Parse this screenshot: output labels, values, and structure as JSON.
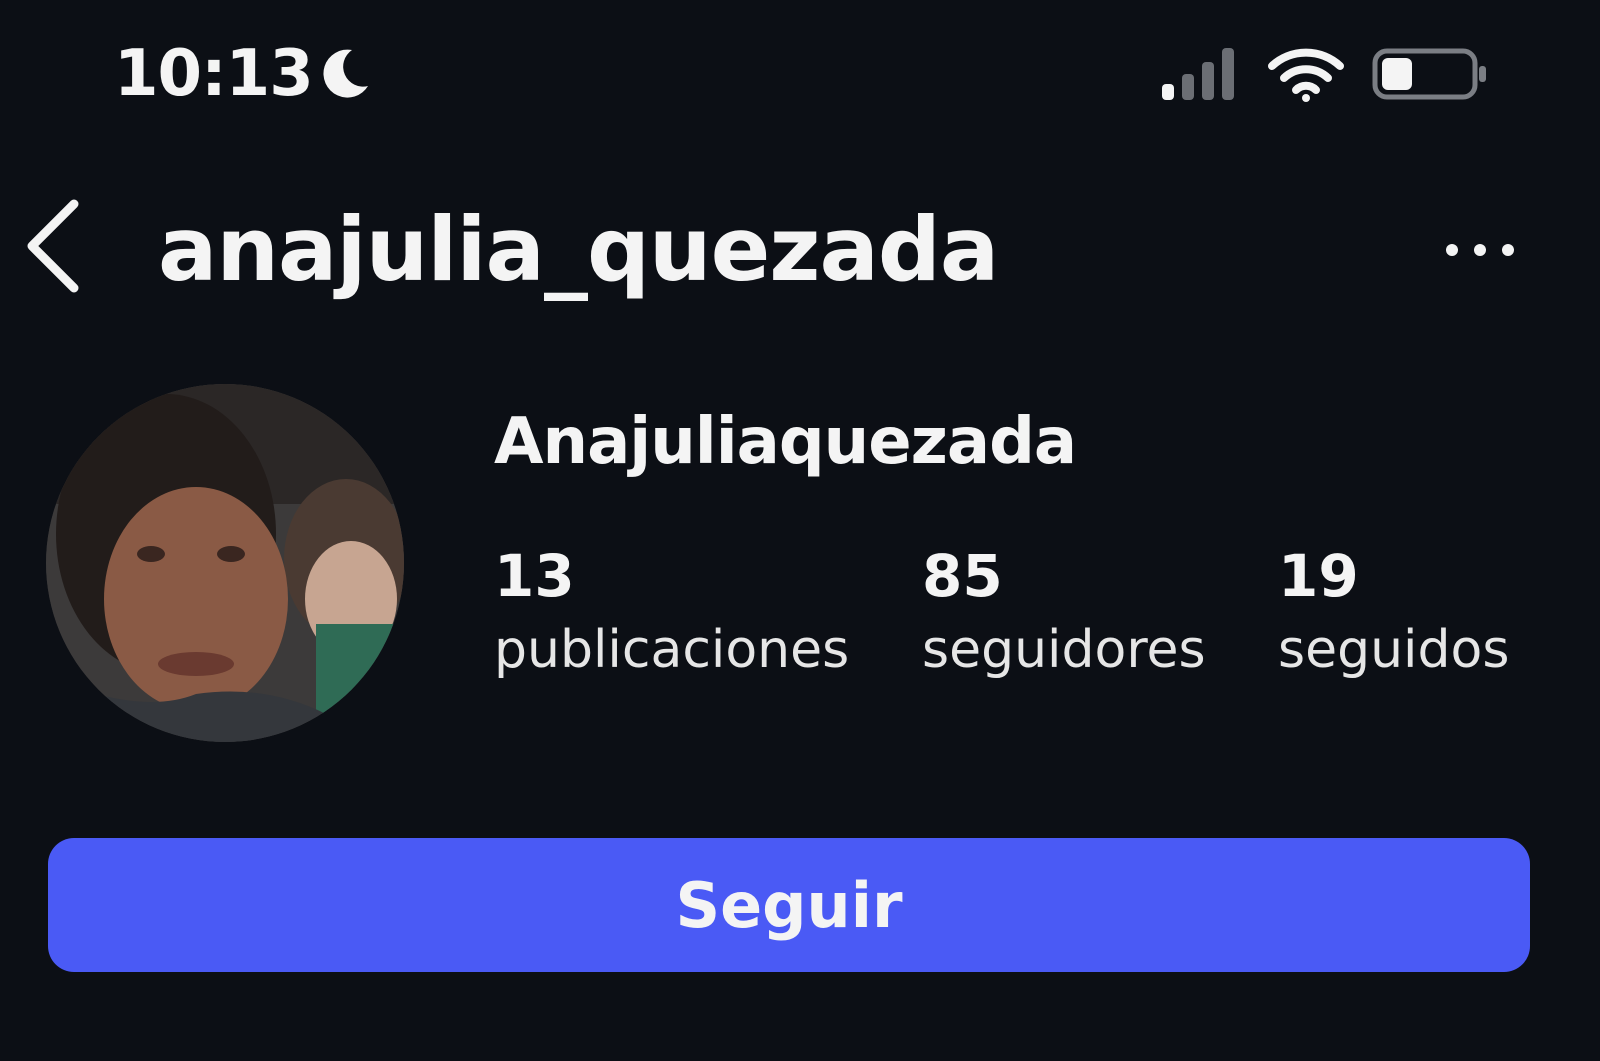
{
  "status_bar": {
    "time": "10:13",
    "focus_icon": "moon-icon",
    "signal_icon": "signal-icon",
    "wifi_icon": "wifi-icon",
    "battery_icon": "battery-icon",
    "battery_level": 0.35
  },
  "header": {
    "username": "anajulia_quezada",
    "back_icon": "chevron-left-icon",
    "more_icon": "more-horizontal-icon"
  },
  "profile": {
    "display_name": "Anajuliaquezada",
    "avatar_icon": "profile-photo",
    "stats": [
      {
        "value": "13",
        "label": "publicaciones"
      },
      {
        "value": "85",
        "label": "seguidores"
      },
      {
        "value": "19",
        "label": "seguidos"
      }
    ]
  },
  "actions": {
    "follow_label": "Seguir"
  },
  "colors": {
    "background": "#0c0f15",
    "accent": "#4a5af5",
    "text": "#f4f4f4"
  }
}
